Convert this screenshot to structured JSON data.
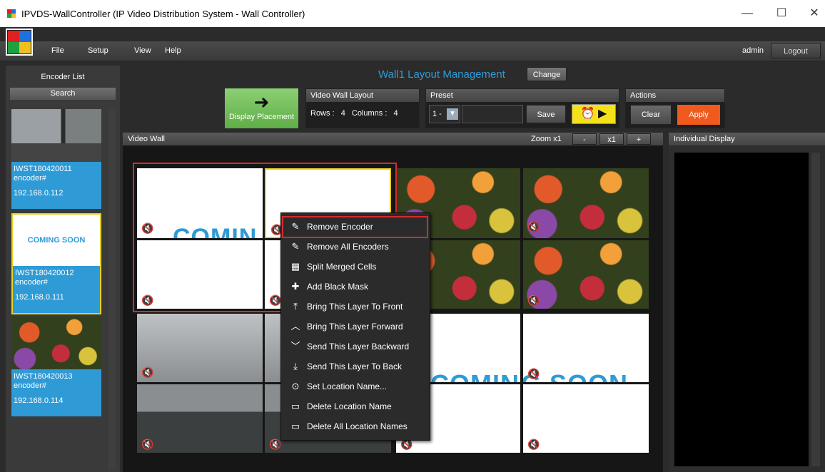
{
  "window": {
    "title": "IPVDS-WallController (IP Video Distribution System - Wall Controller)",
    "minimize": "—",
    "maximize": "☐",
    "close": "✕"
  },
  "menu": {
    "items": [
      "File",
      "Setup",
      "View",
      "Help"
    ],
    "user": "admin",
    "logout": "Logout"
  },
  "sidebar": {
    "header": "Encoder List",
    "search": "Search",
    "encoders": [
      {
        "name": "IWST180420011",
        "type": "encoder#",
        "ip": "192.168.0.112",
        "thumb": "rain-window"
      },
      {
        "name": "IWST180420012",
        "type": "encoder#",
        "ip": "192.168.0.111",
        "thumb": "COMING SOON",
        "selected": true
      },
      {
        "name": "IWST180420013",
        "type": "encoder#",
        "ip": "192.168.0.114",
        "thumb": "flowers"
      }
    ]
  },
  "header": {
    "title": "Wall1 Layout Management",
    "change": "Change"
  },
  "toolbar": {
    "display_placement": "Display Placement",
    "layout_group": "Video Wall Layout",
    "rows_label": "Rows :",
    "rows": "4",
    "cols_label": "Columns :",
    "cols": "4",
    "preset_group": "Preset",
    "preset_value": "1 -",
    "save": "Save",
    "actions_group": "Actions",
    "clear": "Clear",
    "apply": "Apply"
  },
  "videowall": {
    "header": "Video Wall",
    "zoom_label": "Zoom x1",
    "zoom_minus": "-",
    "zoom_reset": "x1",
    "zoom_plus": "+",
    "coming_soon": "COMING SOON",
    "coming_partial": "COMIN"
  },
  "individual": {
    "header": "Individual Display"
  },
  "context_menu": {
    "items": [
      {
        "label": "Remove Encoder",
        "icon": "remove-icon"
      },
      {
        "label": "Remove All Encoders",
        "icon": "remove-all-icon"
      },
      {
        "label": "Split Merged Cells",
        "icon": "grid-icon"
      },
      {
        "label": "Add Black Mask",
        "icon": "plus-icon"
      },
      {
        "label": "Bring This Layer To Front",
        "icon": "to-front-icon"
      },
      {
        "label": "Bring This Layer Forward",
        "icon": "forward-icon"
      },
      {
        "label": "Send This Layer Backward",
        "icon": "backward-icon"
      },
      {
        "label": "Send This Layer To Back",
        "icon": "to-back-icon"
      },
      {
        "label": "Set Location Name...",
        "icon": "location-icon"
      },
      {
        "label": "Delete Location Name",
        "icon": "delete-icon"
      },
      {
        "label": "Delete All Location Names",
        "icon": "delete-all-icon"
      }
    ]
  },
  "colors": {
    "accent": "#2e9bd6",
    "apply": "#f05a1e",
    "display_btn": "#6cbf55",
    "selected_border": "#e8d21c",
    "highlight": "#d62b2b"
  }
}
